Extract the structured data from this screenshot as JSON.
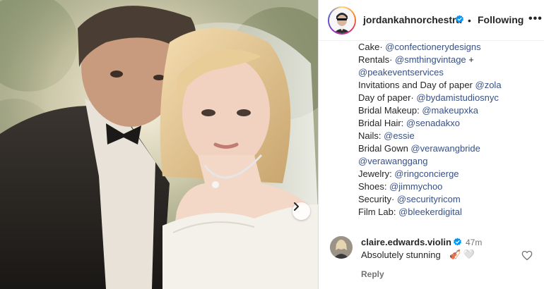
{
  "post": {
    "author": "jordankahnorchestra",
    "verified": true,
    "follow_status": "Following",
    "more_label": "•••",
    "accent_color": "#0095f6",
    "next_button_icon": "chevron-right-icon"
  },
  "caption": {
    "lines": [
      {
        "text": "Cake· ",
        "mention": "@confectionerydesigns"
      },
      {
        "text": "Rentals· ",
        "mention": "@smthingvintage",
        "suffix": " +"
      },
      {
        "text": "",
        "mention": "@peakeventservices"
      },
      {
        "text": "Invitations and Day of paper ",
        "mention": "@zola"
      },
      {
        "text": "Day of paper· ",
        "mention": "@bydamistudiosnyc"
      },
      {
        "text": "Bridal Makeup: ",
        "mention": "@makeupxka"
      },
      {
        "text": "Bridal Hair: ",
        "mention": "@senadakxo"
      },
      {
        "text": "Nails: ",
        "mention": "@essie"
      },
      {
        "text": "Bridal Gown ",
        "mention": "@verawangbride"
      },
      {
        "text": "",
        "mention": "@verawanggang"
      },
      {
        "text": "Jewelry: ",
        "mention": "@ringconcierge"
      },
      {
        "text": "Shoes: ",
        "mention": "@jimmychoo"
      },
      {
        "text": "Security· ",
        "mention": "@securityricom"
      },
      {
        "text": "Film Lab: ",
        "mention": "@bleekerdigital"
      }
    ]
  },
  "comment": {
    "user": "claire.edwards.violin",
    "verified": true,
    "time": "47m",
    "text": "Absolutely stunning",
    "emoji": "🎻 🤍",
    "reply_label": "Reply",
    "like_icon": "heart-outline-icon"
  }
}
